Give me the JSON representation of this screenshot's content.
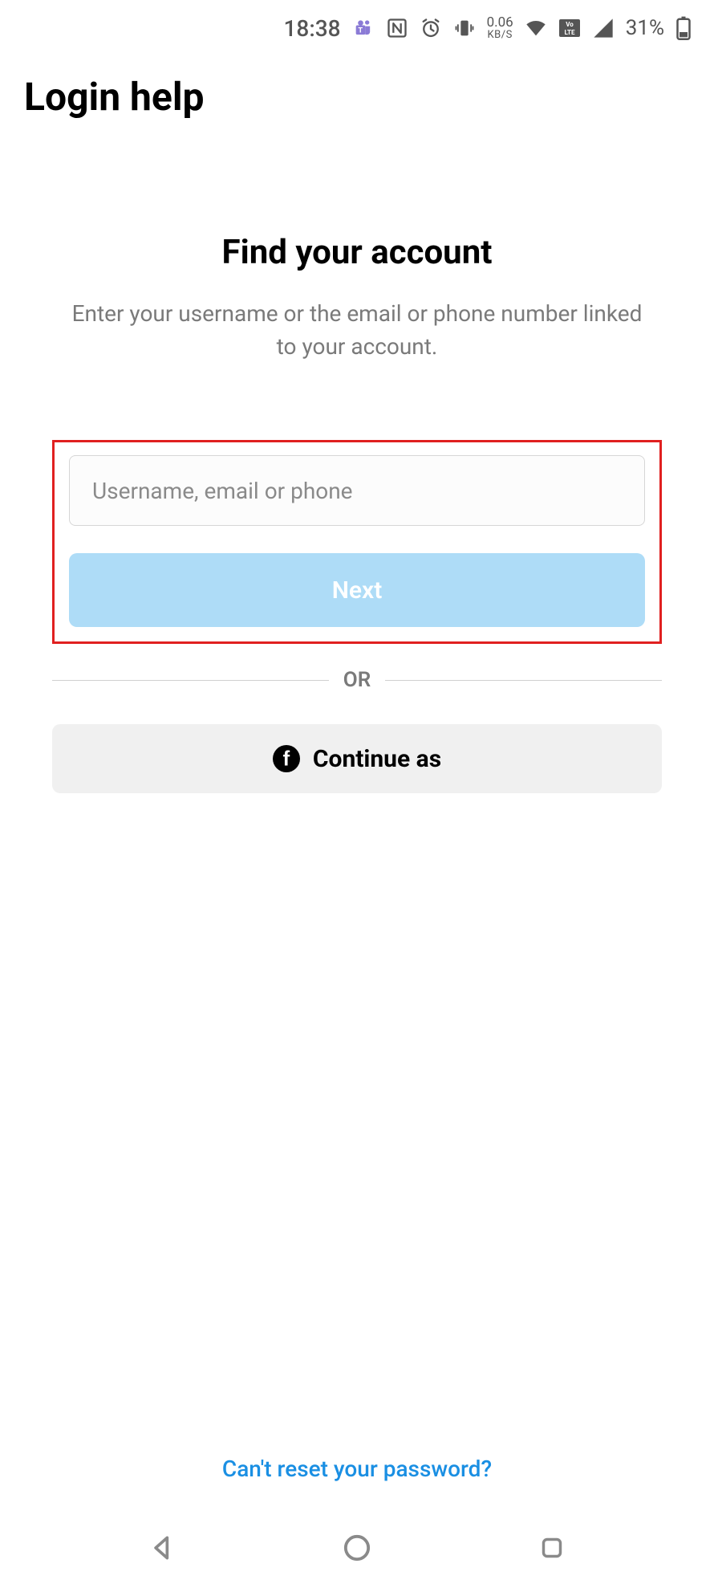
{
  "status": {
    "time": "18:38",
    "net_speed_top": "0.06",
    "net_speed_bot": "KB/S",
    "battery_percent": "31%"
  },
  "header": {
    "title": "Login help"
  },
  "main": {
    "title": "Find your account",
    "subtitle": "Enter your username or the email or phone number linked to your account.",
    "input_placeholder": "Username, email or phone",
    "next_label": "Next",
    "or_label": "OR",
    "facebook_label": "Continue as"
  },
  "footer": {
    "help_link": "Can't reset your password?"
  }
}
